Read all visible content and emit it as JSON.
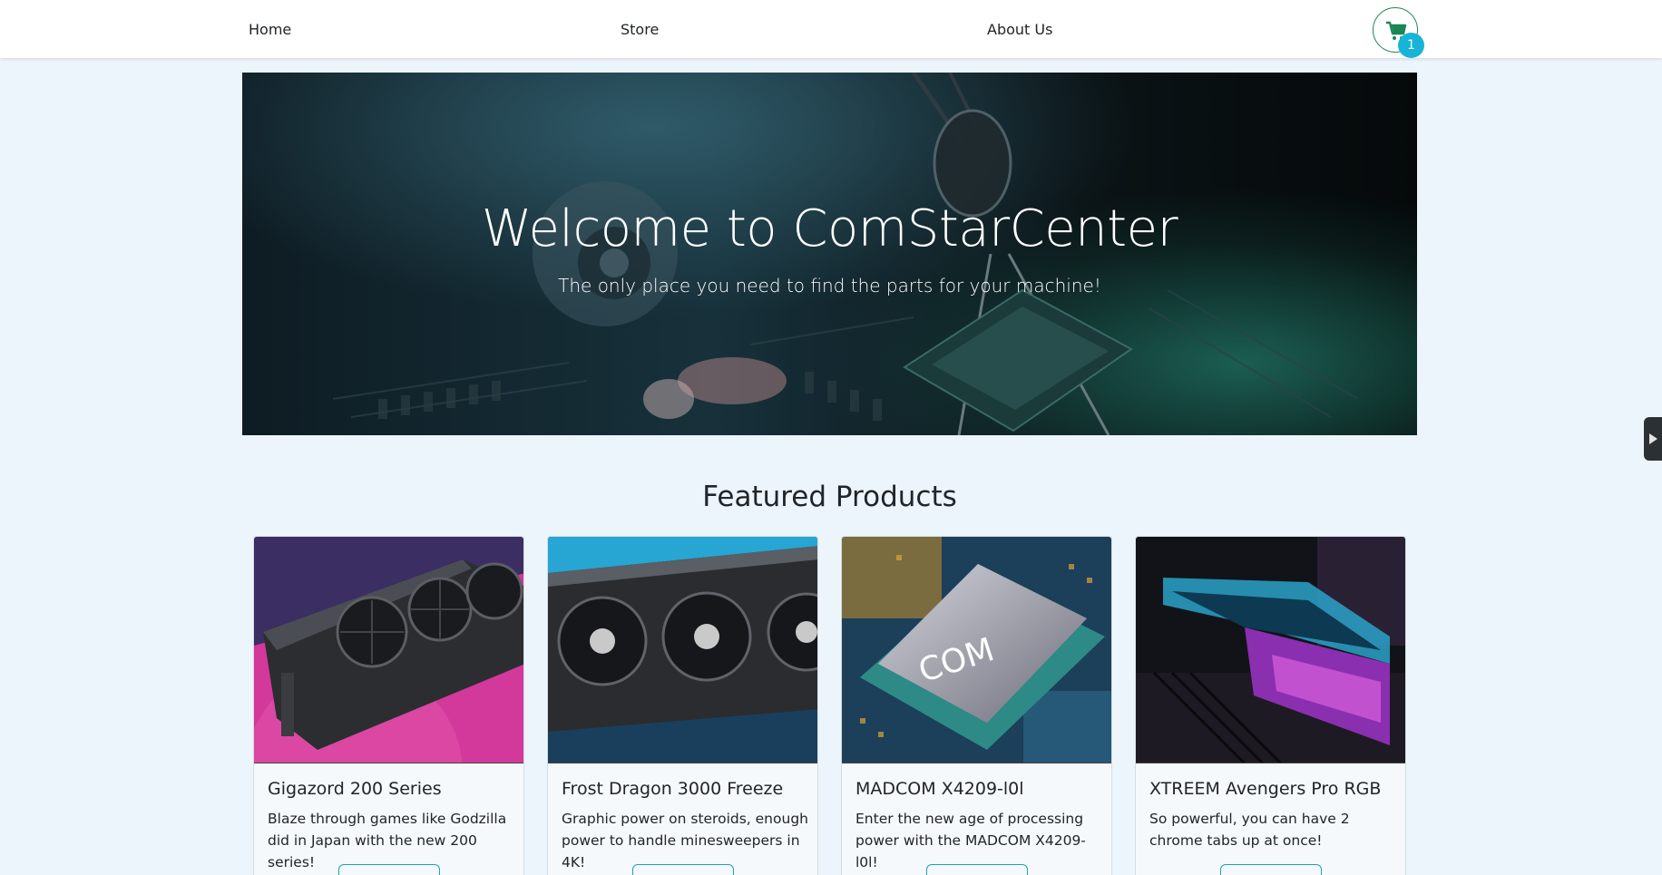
{
  "nav": {
    "home": "Home",
    "store": "Store",
    "about": "About Us",
    "cart_icon": "cart-icon",
    "cart_count": "1",
    "accent": "#198754",
    "badge_color": "#17b4d8"
  },
  "hero": {
    "title": "Welcome to ComStarCenter",
    "subtitle": "The only place you need to find the parts for your machine!"
  },
  "featured": {
    "heading": "Featured Products",
    "products": [
      {
        "name": "Gigazord 200 Series",
        "description": "Blaze through games like Godzilla did in Japan with the new 200 series!"
      },
      {
        "name": "Frost Dragon 3000 Freeze",
        "description": "Graphic power on steroids, enough power to handle minesweepers in 4K!"
      },
      {
        "name": "MADCOM X4209-l0l",
        "description": "Enter the new age of processing power with the MADCOM X4209-l0l!"
      },
      {
        "name": "XTREEM Avengers Pro RGB",
        "description": "So powerful, you can have 2 chrome tabs up at once!"
      }
    ]
  },
  "sidebar_toggle_icon": "caret-right-icon"
}
